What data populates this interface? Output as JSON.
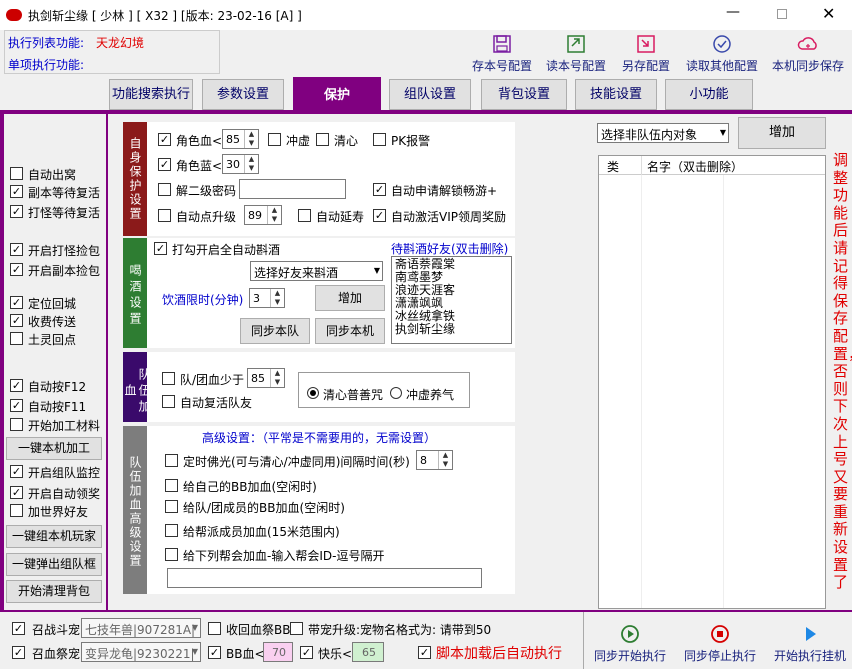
{
  "app": {
    "title": "执剑斩尘缘 [ 少林 ] [ X32 ] [版本: 23-02-16 [A] ]",
    "exec_list_label": "执行列表功能:",
    "exec_list_value": "天龙幻境",
    "single_exec_label": "单项执行功能:"
  },
  "toolbar": [
    {
      "label": "存本号配置",
      "icon": "save-icon"
    },
    {
      "label": "读本号配置",
      "icon": "load-icon"
    },
    {
      "label": "另存配置",
      "icon": "save-as-icon"
    },
    {
      "label": "读取其他配置",
      "icon": "check-circle-icon"
    },
    {
      "label": "本机同步保存",
      "icon": "cloud-sync-icon"
    }
  ],
  "tabs": [
    "功能搜索执行",
    "参数设置",
    "保护",
    "组队设置",
    "背包设置",
    "技能设置",
    "小功能"
  ],
  "left": {
    "auto_exit_cave": "自动出窝",
    "dungeon_wait_revive": "副本等待复活",
    "blood_wait_revive": "打怪等待复活",
    "start_blood_pickup": "开启打怪捡包",
    "start_dungeon_pickup": "开启副本捡包",
    "locate_return": "定位回城",
    "collect_teleport": "收费传送",
    "earth_return": "土灵回点",
    "auto_f12": "自动按F12",
    "auto_f11": "自动按F11",
    "start_material": "开始加工材料",
    "one_click_process": "一键本机加工",
    "start_team_monitor": "开启组队监控",
    "start_auto_reward": "开启自动领奖",
    "add_world_friend": "加世界好友",
    "one_click_group": "一键组本机玩家",
    "one_click_popup": "一键弹出组队框",
    "start_clean_bag": "开始清理背包"
  },
  "self": {
    "section": "自身保护设置",
    "hp_label": "角色血<",
    "hp_value": "85",
    "chong": "冲虚",
    "qingxin": "清心",
    "pk": "PK报警",
    "mp_label": "角色蓝<",
    "mp_value": "30",
    "pwd_label": "解二级密码",
    "auto_unlock": "自动申请解锁畅游+",
    "auto_level": "自动点升级",
    "level_value": "89",
    "auto_extend": "自动延寿",
    "vip": "自动激活VIP领周奖励"
  },
  "drink": {
    "section": "喝酒设置",
    "enable_label": "打勾开启全自动斟酒",
    "select_value": "选择好友来斟酒",
    "limit_label": "饮酒限时(分钟)",
    "limit_value": "3",
    "add": "增加",
    "sync_team": "同步本队",
    "sync_local": "同步本机",
    "friends_title": "待斟酒好友(双击删除)",
    "friends": [
      "斋语萘霞棠",
      "南鸢墨梦",
      "浪迹天涯客",
      "潇潇飒飒",
      "冰丝绒拿铁",
      "执剑斩尘缘"
    ]
  },
  "team": {
    "section": "队伍加血",
    "less_label": "队/团血少于",
    "less_value": "85",
    "revive": "自动复活队友",
    "radio_a": "清心普善咒",
    "radio_b": "冲虚养气"
  },
  "adv": {
    "section": "队伍加血高级设置",
    "title": "高级设置：（平常是不需要用的，无需设置）",
    "timed": "定时佛光(可与清心/冲虚同用)间隔时间(秒)",
    "timed_value": "8",
    "opt2": "给自己的BB加血(空闲时)",
    "opt3": "给队/团成员的BB加血(空闲时)",
    "opt4": "给帮派成员加血(15米范围内)",
    "opt5": "给下列帮会加血-输入帮会ID-逗号隔开"
  },
  "right": {
    "select_value": "选择非队伍内对象",
    "add": "增加",
    "col_type": "类",
    "col_name": "名字（双击删除）",
    "note": "调整功能后请记得保存配置，否则下次上号又要重新设置了"
  },
  "bottom": {
    "pet1_label": "召战斗宠",
    "pet1_value": "七技年兽|907281A|",
    "recall_label": "收回血祭BB",
    "pet_upgrade": "带宠升级:宠物名格式为: 请带到50",
    "pet2_label": "召血祭宠",
    "pet2_value": "变异龙龟|9230221|",
    "bb_label": "BB血<",
    "bb_value": "70",
    "happy_label": "快乐<",
    "happy_value": "65",
    "auto_exec": "脚本加载后自动执行",
    "sync_start": "同步开始执行",
    "sync_stop": "同步停止执行",
    "start_hang": "开始执行挂机"
  },
  "colors": {
    "accent": "#800080",
    "self_bar": "#8b1a1a",
    "drink_bar": "#2e7d32",
    "team_bar": "#3a0a6b",
    "adv_bar": "#7d7d7d"
  }
}
